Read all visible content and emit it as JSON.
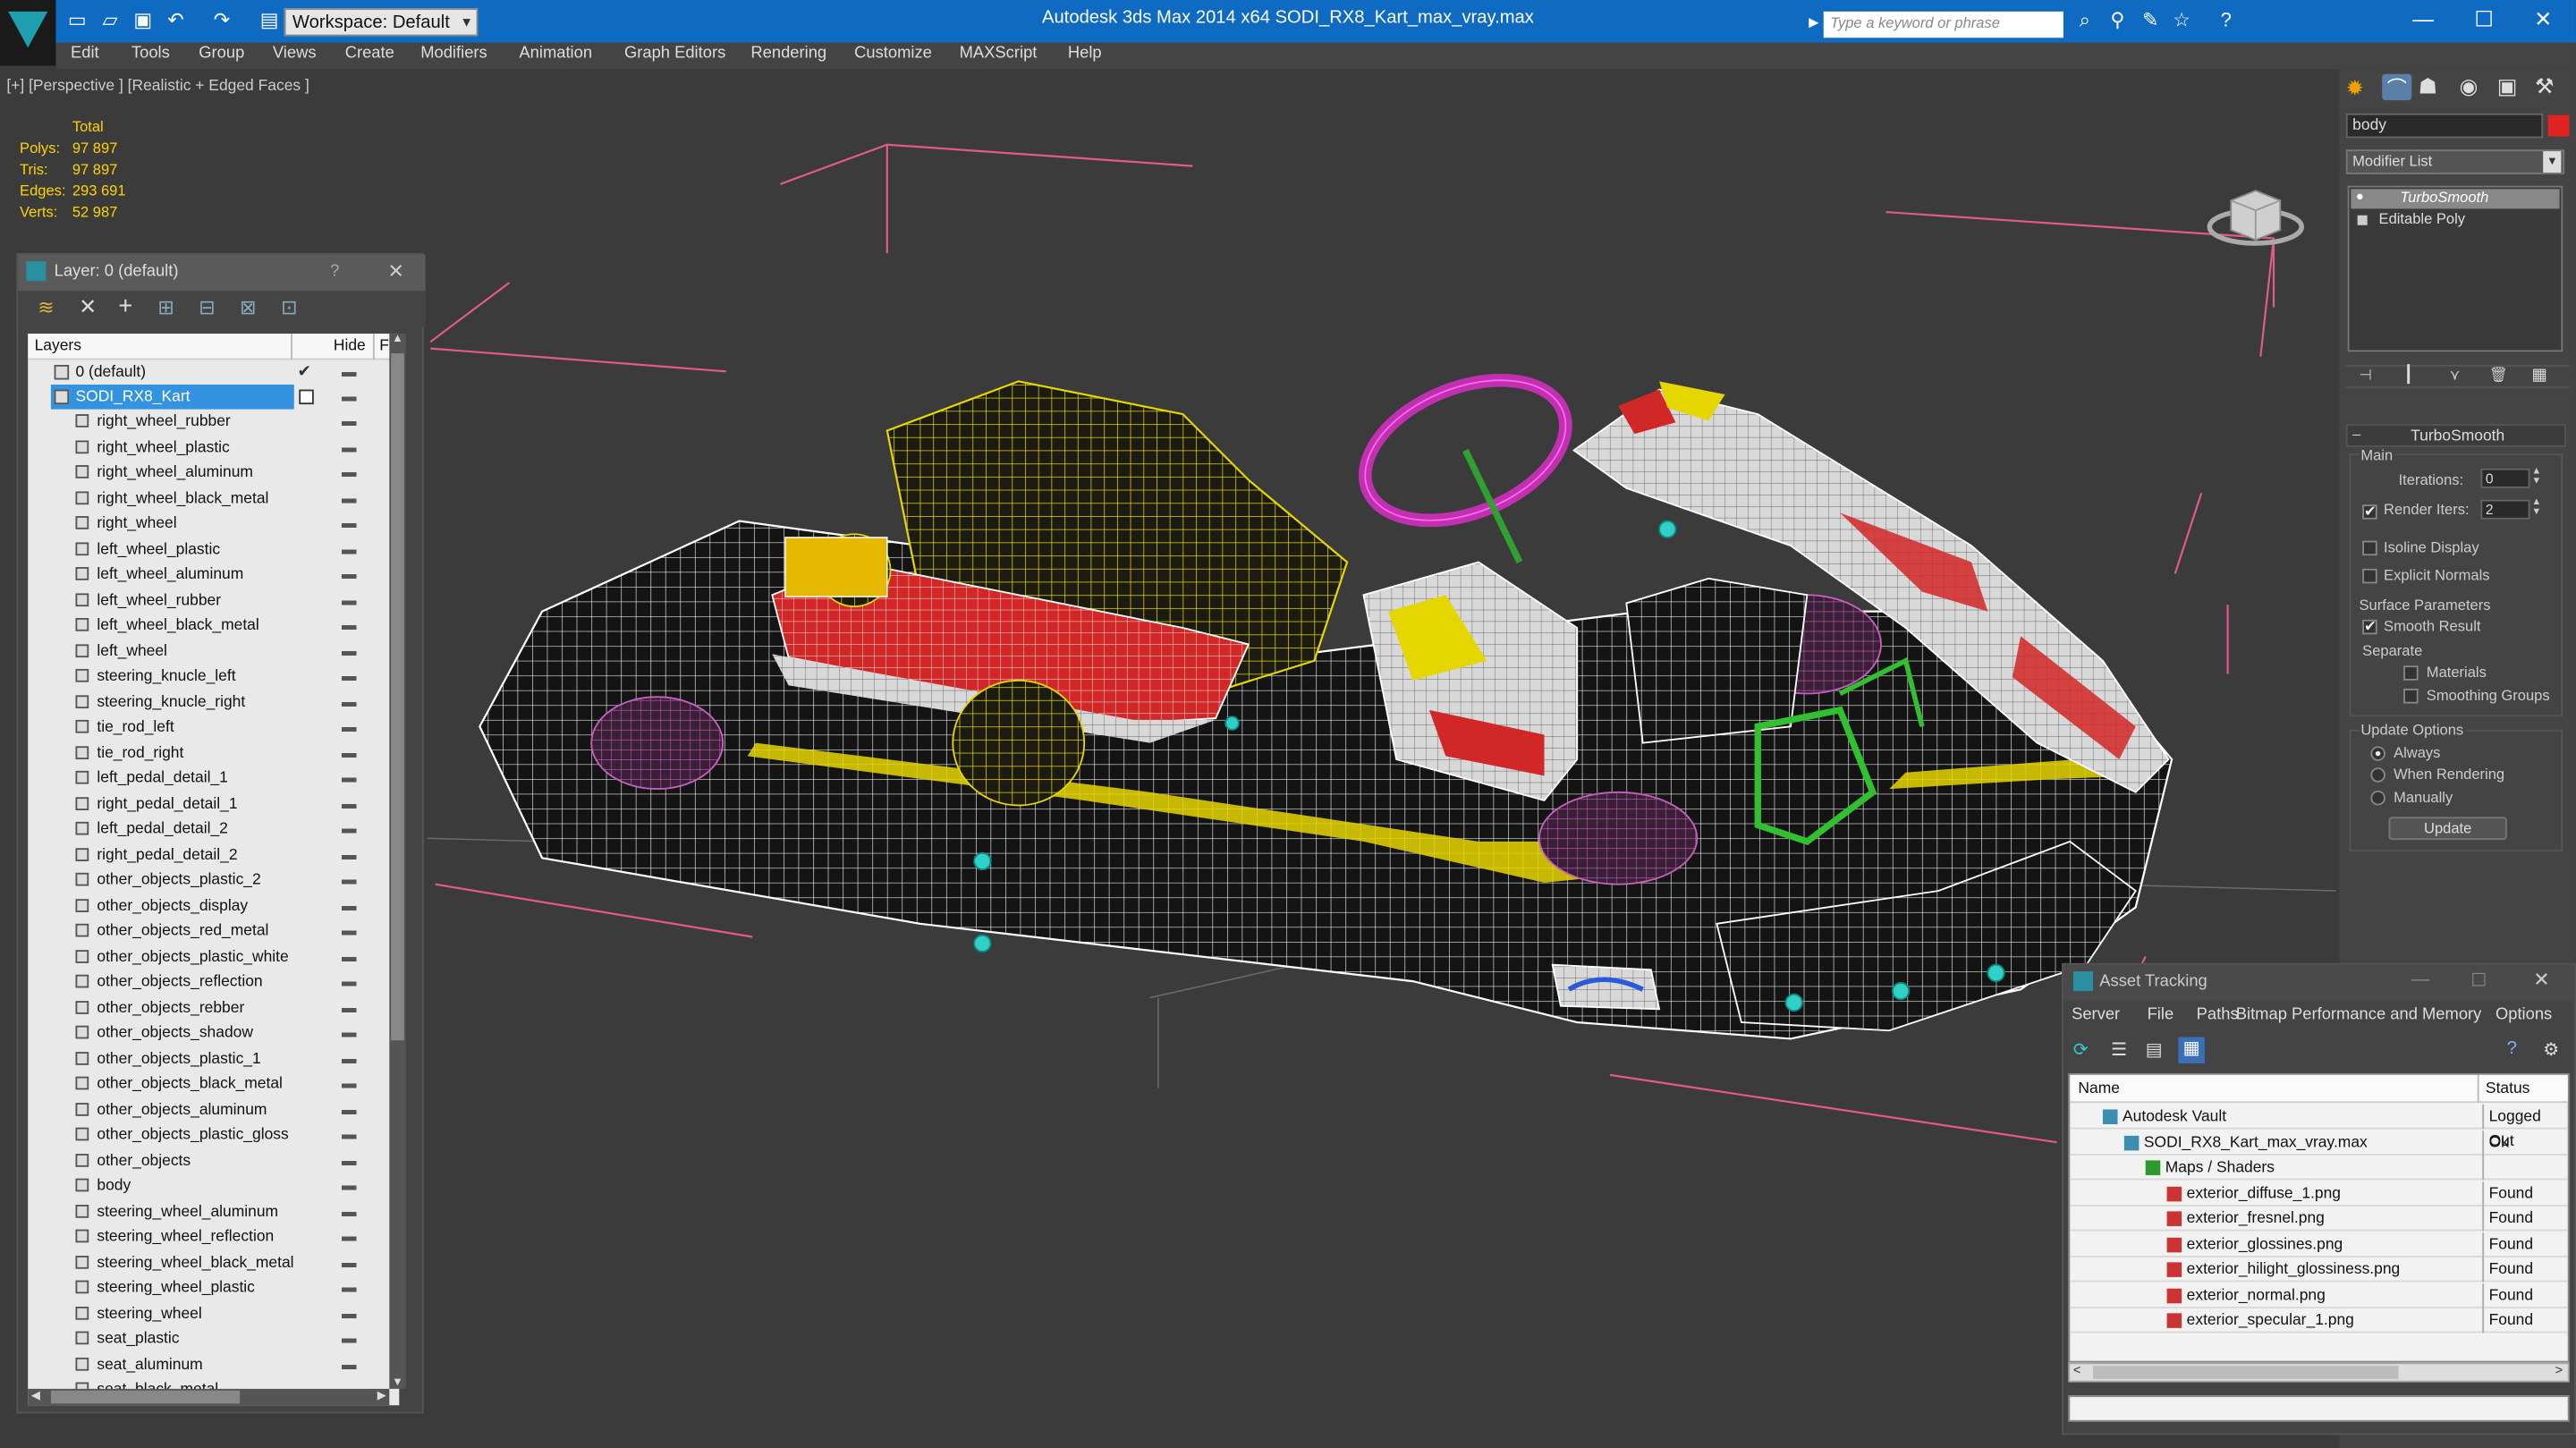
{
  "app": {
    "window_title": "Autodesk 3ds Max  2014 x64     SODI_RX8_Kart_max_vray.max",
    "workspace_label": "Workspace: Default",
    "search_placeholder": "Type a keyword or phrase",
    "accent": "#0f6ac2"
  },
  "menu": [
    "Edit",
    "Tools",
    "Group",
    "Views",
    "Create",
    "Modifiers",
    "Animation",
    "Graph Editors",
    "Rendering",
    "Customize",
    "MAXScript",
    "Help"
  ],
  "viewport": {
    "label": "[+] [Perspective ] [Realistic + Edged Faces ]",
    "stats": {
      "header": "Total",
      "rows": [
        {
          "label": "Polys:",
          "value": "97 897"
        },
        {
          "label": "Tris:",
          "value": "97 897"
        },
        {
          "label": "Edges:",
          "value": "293 691"
        },
        {
          "label": "Verts:",
          "value": "52 987"
        }
      ]
    }
  },
  "layer_panel": {
    "title": "Layer: 0 (default)",
    "help": "?",
    "col_layers": "Layers",
    "col_hide": "Hide",
    "col_f": "F",
    "default_layer": "0 (default)",
    "selected_layer": "SODI_RX8_Kart",
    "objects": [
      "right_wheel_rubber",
      "right_wheel_plastic",
      "right_wheel_aluminum",
      "right_wheel_black_metal",
      "right_wheel",
      "left_wheel_plastic",
      "left_wheel_aluminum",
      "left_wheel_rubber",
      "left_wheel_black_metal",
      "left_wheel",
      "steering_knucle_left",
      "steering_knucle_right",
      "tie_rod_left",
      "tie_rod_right",
      "left_pedal_detail_1",
      "right_pedal_detail_1",
      "left_pedal_detail_2",
      "right_pedal_detail_2",
      "other_objects_plastic_2",
      "other_objects_display",
      "other_objects_red_metal",
      "other_objects_plastic_white",
      "other_objects_reflection",
      "other_objects_rebber",
      "other_objects_shadow",
      "other_objects_plastic_1",
      "other_objects_black_metal",
      "other_objects_aluminum",
      "other_objects_plastic_gloss",
      "other_objects",
      "body",
      "steering_wheel_aluminum",
      "steering_wheel_reflection",
      "steering_wheel_black_metal",
      "steering_wheel_plastic",
      "steering_wheel",
      "seat_plastic",
      "seat_aluminum",
      "seat_black_metal"
    ]
  },
  "command_panel": {
    "object_name": "body",
    "object_color": "#e0231f",
    "modifier_list": "Modifier List",
    "stack": [
      "TurboSmooth",
      "Editable Poly"
    ],
    "rollout_title": "TurboSmooth",
    "main_label": "Main",
    "iterations_label": "Iterations:",
    "iterations_value": "0",
    "render_iters_label": "Render Iters:",
    "render_iters_value": "2",
    "isoline_label": "Isoline Display",
    "explicit_label": "Explicit Normals",
    "surface_label": "Surface Parameters",
    "smooth_result_label": "Smooth Result",
    "separate_label": "Separate",
    "materials_label": "Materials",
    "smoothing_groups_label": "Smoothing Groups",
    "update_options_label": "Update Options",
    "always_label": "Always",
    "when_rendering_label": "When Rendering",
    "manually_label": "Manually",
    "update_button": "Update"
  },
  "asset_tracking": {
    "title": "Asset Tracking",
    "menu": [
      "Server",
      "File",
      "Paths",
      "Bitmap Performance and Memory",
      "Options"
    ],
    "col_name": "Name",
    "col_status": "Status",
    "rows": [
      {
        "name": "Autodesk Vault",
        "status": "Logged Out",
        "indent": 0
      },
      {
        "name": "SODI_RX8_Kart_max_vray.max",
        "status": "Ok",
        "indent": 1
      },
      {
        "name": "Maps / Shaders",
        "status": "",
        "indent": 2
      },
      {
        "name": "exterior_diffuse_1.png",
        "status": "Found",
        "indent": 3
      },
      {
        "name": "exterior_fresnel.png",
        "status": "Found",
        "indent": 3
      },
      {
        "name": "exterior_glossines.png",
        "status": "Found",
        "indent": 3
      },
      {
        "name": "exterior_hilight_glossiness.png",
        "status": "Found",
        "indent": 3
      },
      {
        "name": "exterior_normal.png",
        "status": "Found",
        "indent": 3
      },
      {
        "name": "exterior_specular_1.png",
        "status": "Found",
        "indent": 3
      }
    ]
  }
}
